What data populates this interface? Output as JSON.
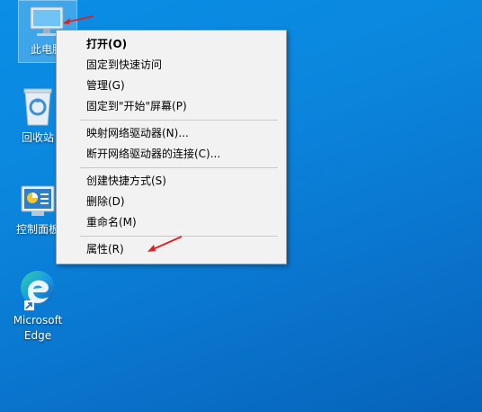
{
  "colors": {
    "desktop_bg": "#0b86dd",
    "menu_bg": "#f2f2f2",
    "annotation_arrow": "#e02020"
  },
  "desktop_icons": [
    {
      "label": "此电脑",
      "icon": "computer-icon",
      "selected": true
    },
    {
      "label": "回收站",
      "icon": "recycle-bin-icon"
    },
    {
      "label": "控制面板",
      "icon": "control-panel-icon"
    },
    {
      "label_line1": "Microsoft",
      "label_line2": "Edge",
      "icon": "edge-icon"
    }
  ],
  "context_menu": {
    "groups": [
      [
        {
          "label": "打开(O)",
          "bold": true
        },
        {
          "label": "固定到快速访问"
        },
        {
          "label": "管理(G)"
        },
        {
          "label": "固定到\"开始\"屏幕(P)"
        }
      ],
      [
        {
          "label": "映射网络驱动器(N)..."
        },
        {
          "label": "断开网络驱动器的连接(C)..."
        }
      ],
      [
        {
          "label": "创建快捷方式(S)"
        },
        {
          "label": "删除(D)"
        },
        {
          "label": "重命名(M)"
        }
      ],
      [
        {
          "label": "属性(R)"
        }
      ]
    ]
  }
}
